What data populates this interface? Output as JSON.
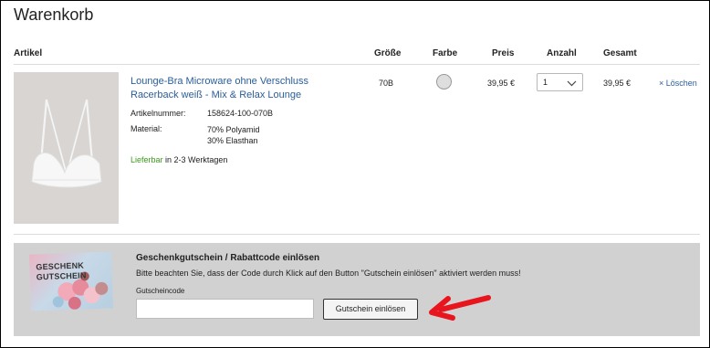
{
  "page": {
    "title": "Warenkorb"
  },
  "table_header": {
    "article": "Artikel",
    "size": "Größe",
    "color": "Farbe",
    "price": "Preis",
    "quantity": "Anzahl",
    "total": "Gesamt"
  },
  "item": {
    "name": "Lounge-Bra Microware ohne Verschluss Racerback weiß - Mix & Relax Lounge",
    "article_no_label": "Artikelnummer:",
    "article_no": "158624-100-070B",
    "material_label": "Material:",
    "material_line1": "70% Polyamid",
    "material_line2": "30% Elasthan",
    "availability_status": "Lieferbar",
    "availability_text": " in 2-3 Werktagen",
    "size": "70B",
    "color_swatch": "#dedede",
    "price": "39,95 €",
    "quantity": "1",
    "total": "39,95 €",
    "remove_label": "× Löschen"
  },
  "voucher": {
    "card_line1": "GESCHENK",
    "card_line2": "GUTSCHEIN",
    "title": "Geschenkgutschein / Rabattcode einlösen",
    "note": "Bitte beachten Sie, dass der Code durch Klick auf den Button \"Gutschein einlösen\" aktiviert werden muss!",
    "field_label": "Gutscheincode",
    "field_value": "",
    "button_label": "Gutschein einlösen"
  },
  "colors": {
    "link": "#2a5d9a",
    "available": "#3a9a1a",
    "annotation_arrow": "#e8141e",
    "voucher_bg": "#d1d1d1"
  }
}
